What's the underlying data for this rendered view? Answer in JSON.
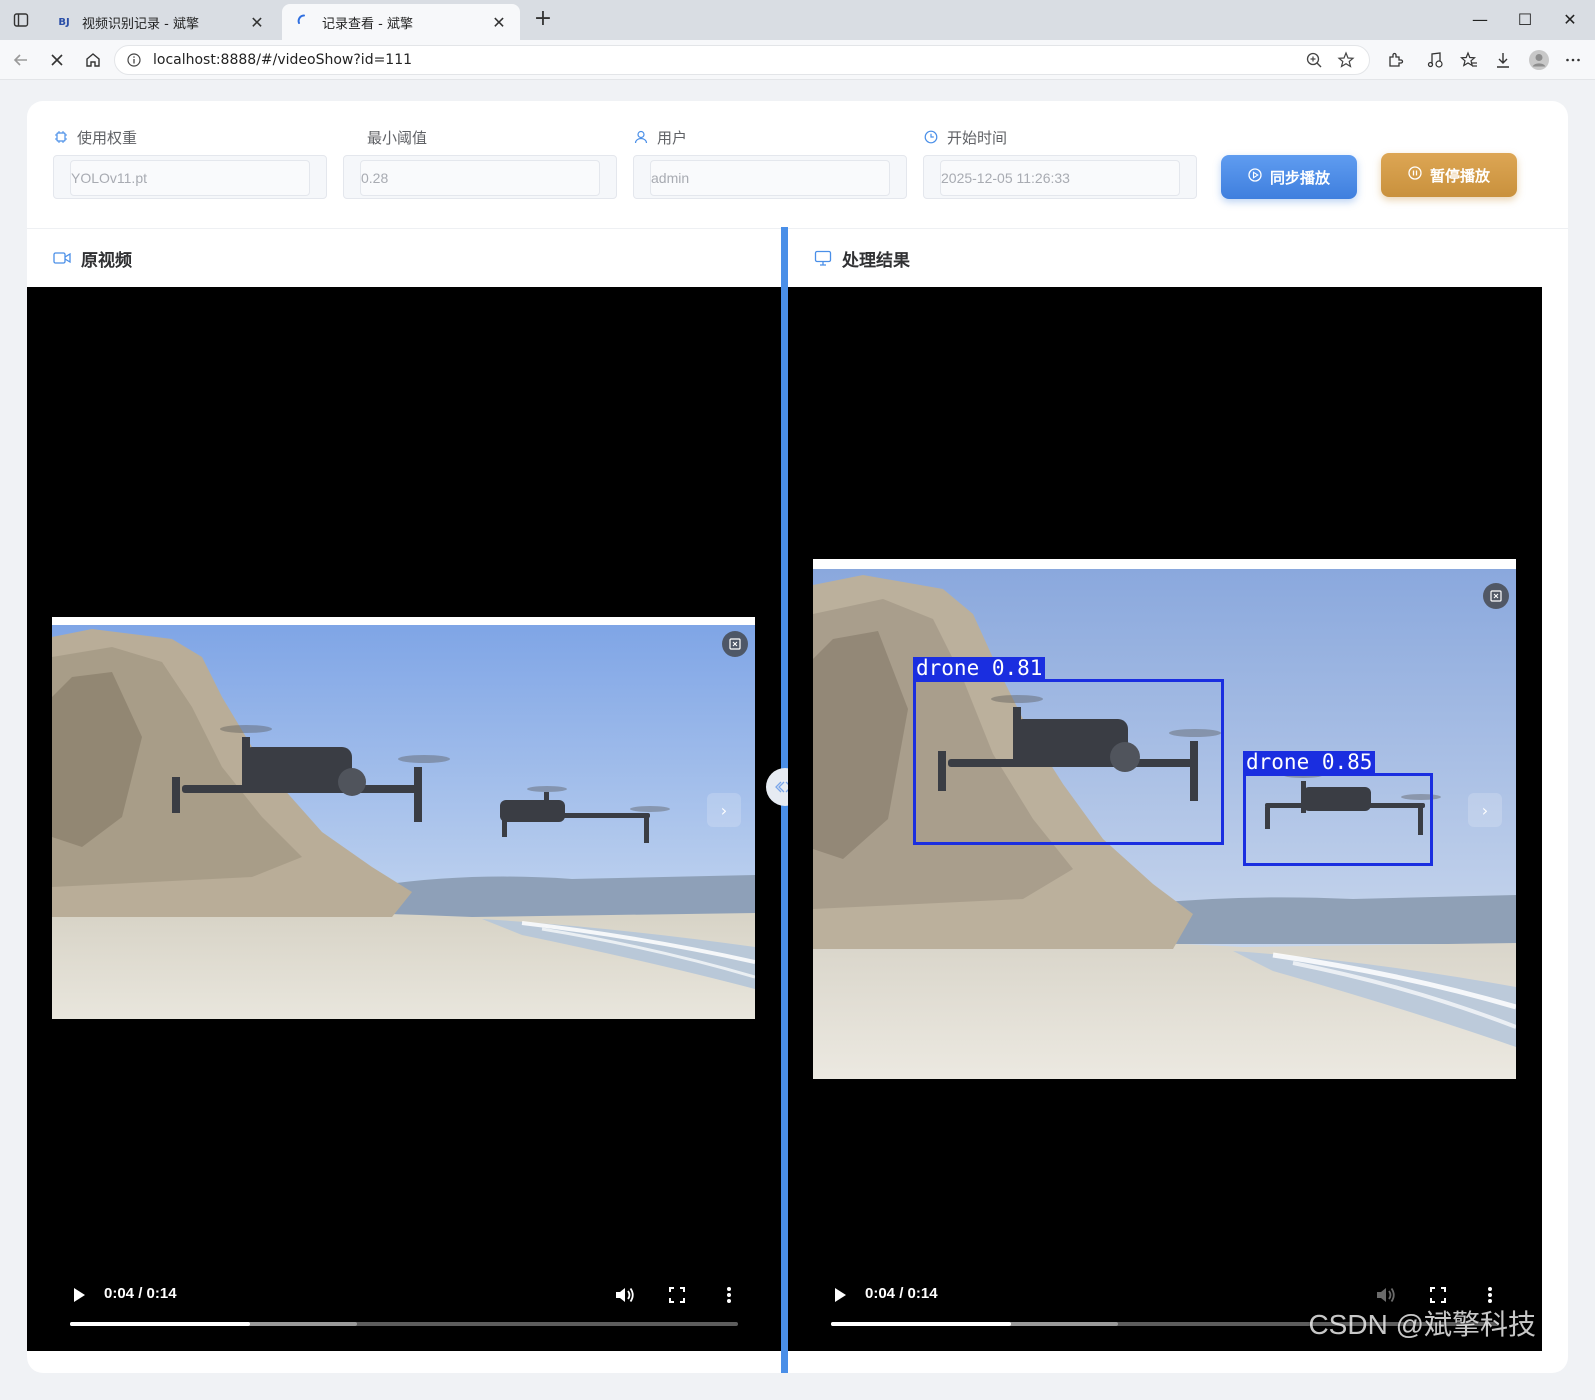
{
  "browser": {
    "tabs": [
      {
        "favicon_text": "BJ",
        "title": "视频识别记录 - 斌擎",
        "active": false
      },
      {
        "favicon_text": "",
        "title": "记录查看 - 斌擎",
        "active": true
      }
    ],
    "url": "localhost:8888/#/videoShow?id=111"
  },
  "form": {
    "weight_label": "使用权重",
    "weight_value": "YOLOv11.pt",
    "threshold_label": "最小阈值",
    "threshold_value": "0.28",
    "user_label": "用户",
    "user_value": "admin",
    "start_time_label": "开始时间",
    "start_time_value": "2025-12-05 11:26:33",
    "sync_button": "同步播放",
    "pause_button": "暂停播放"
  },
  "panels": {
    "original_title": "原视频",
    "result_title": "处理结果"
  },
  "videos": {
    "original": {
      "time": "0:04 / 0:14",
      "played_fraction": 0.27,
      "buffered_fraction": 0.43
    },
    "result": {
      "time": "0:04 / 0:14",
      "played_fraction": 0.27,
      "buffered_fraction": 0.43
    }
  },
  "detections": [
    {
      "label": "drone 0.81"
    },
    {
      "label": "drone 0.85"
    }
  ],
  "watermark": "CSDN @斌擎科技",
  "colors": {
    "accent_blue": "#4a8fe8",
    "pause_gold": "#d19a46",
    "detection_blue": "#1a2ee0"
  }
}
